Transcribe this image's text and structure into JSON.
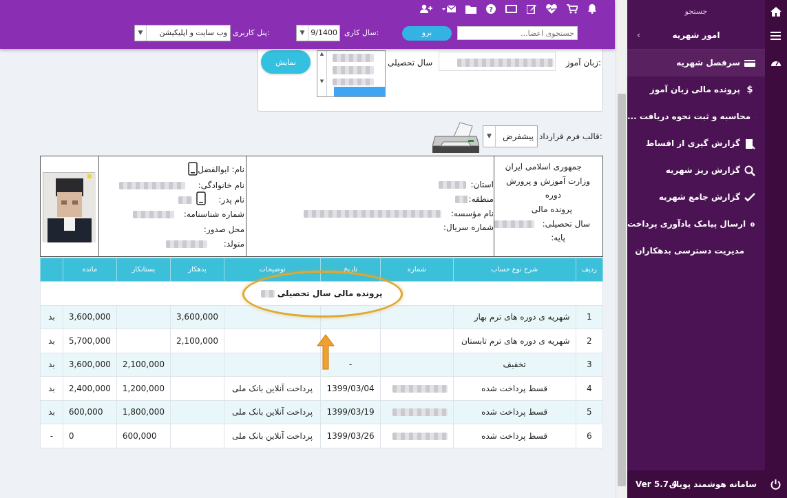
{
  "topbar": {
    "search_placeholder": "جستجوی اعضا...",
    "go_label": "برو",
    "year_label": "سال کاری:",
    "year_value": "9/1400",
    "panel_label": "پنل کاربری:",
    "panel_value": "وب سایت و اپلیکیشن"
  },
  "sidebar": {
    "search_label": "جستجو",
    "section_title": "امور شهریه",
    "items": [
      {
        "label": "سرفصل شهریه"
      },
      {
        "label": "پرونده مالی زبان آموز"
      },
      {
        "label": "محاسبه و ثبت نحوه دریافت ..."
      },
      {
        "label": "گزارش گیری از اقساط"
      },
      {
        "label": "گزارش ریز شهریه"
      },
      {
        "label": "گزارش جامع شهریه"
      },
      {
        "label": "ارسال پیامک یادآوری پرداخت"
      },
      {
        "label": "مدیریت دسترسی بدهکاران"
      }
    ],
    "footer_name": "سامانه هوشمند پویان",
    "footer_version": "Ver 5.7.4"
  },
  "filter": {
    "student_label": "زبان آموز:",
    "year_label": "سال تحصیلی",
    "show_label": "نمایش"
  },
  "print": {
    "contract_label": "قالب فرم قرارداد:",
    "contract_value": "پیشفرض"
  },
  "info": {
    "header_lines": [
      "جمهوری اسلامی ایران",
      "وزارت آموزش و پرورش",
      "دوره",
      "پرونده مالی"
    ],
    "year_label": "سال تحصیلی:",
    "grade_label": "پایه:",
    "province_label": "استان:",
    "region_label": "منطقه:",
    "institute_label": "نام مؤسسه:",
    "serial_label": "شماره سریال:",
    "first_name_label": "نام: ابوالفضل",
    "last_name_label": "نام خانوادگی:",
    "father_label": "نام پدر:",
    "id_label": "شماره شناسنامه:",
    "issue_label": "محل صدور:",
    "birth_label": "متولد:"
  },
  "table": {
    "headers": [
      "ردیف",
      "شرح نوع حساب",
      "شماره",
      "تاریخ",
      "توضیحات",
      "بدهکار",
      "بستانکار",
      "مانده",
      ""
    ],
    "title_row": "پرونده مالی سال تحصیلی",
    "rows": [
      {
        "idx": "1",
        "desc": "شهریه ی دوره های ترم بهار",
        "date": "",
        "note": "",
        "debit": "3,600,000",
        "credit": "",
        "balance": "3,600,000",
        "status": "بد"
      },
      {
        "idx": "2",
        "desc": "شهریه ی دوره های ترم تابستان",
        "date": "",
        "note": "",
        "debit": "2,100,000",
        "credit": "",
        "balance": "5,700,000",
        "status": "بد"
      },
      {
        "idx": "3",
        "desc": "تخفیف",
        "date": "-",
        "note": "",
        "debit": "",
        "credit": "2,100,000",
        "balance": "3,600,000",
        "status": "بد"
      },
      {
        "idx": "4",
        "desc": "قسط پرداخت شده",
        "date": "1399/03/04",
        "note": "پرداخت آنلاین بانک ملی",
        "debit": "",
        "credit": "1,200,000",
        "balance": "2,400,000",
        "status": "بد"
      },
      {
        "idx": "5",
        "desc": "قسط پرداخت شده",
        "date": "1399/03/19",
        "note": "پرداخت آنلاین بانک ملی",
        "debit": "",
        "credit": "1,800,000",
        "balance": "600,000",
        "status": "بد"
      },
      {
        "idx": "6",
        "desc": "قسط پرداخت شده",
        "date": "1399/03/26",
        "note": "پرداخت آنلاین بانک ملی",
        "debit": "",
        "credit": "600,000",
        "balance": "0",
        "status": "-"
      }
    ]
  },
  "colors": {
    "topbar": "#8a2fb4",
    "sidebar": "#4b1353",
    "table_header": "#3cbfd9",
    "accent": "#34b2e4",
    "highlight": "#e0a830"
  }
}
